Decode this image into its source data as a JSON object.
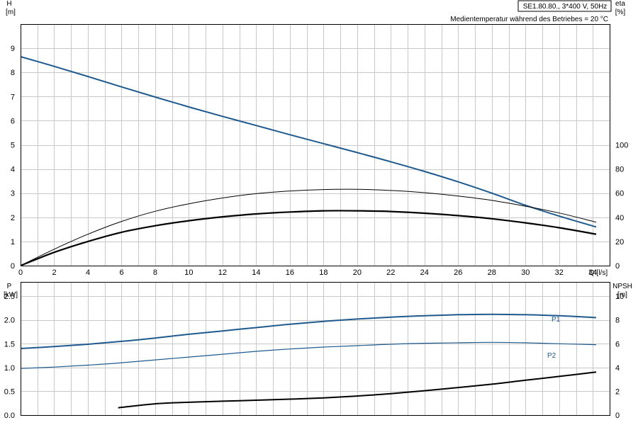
{
  "chart_data": [
    {
      "type": "line",
      "axis": {
        "xlabel": "Q [l/s]",
        "xlim": [
          0,
          35
        ],
        "xticks": [
          0,
          2,
          4,
          6,
          8,
          10,
          12,
          14,
          16,
          18,
          20,
          22,
          24,
          26,
          28,
          30,
          32,
          34
        ],
        "ylabel_line1": "H",
        "ylabel_line2": "[m]",
        "ylim": [
          0,
          10
        ],
        "yticks": [
          0,
          1,
          2,
          3,
          4,
          5,
          6,
          7,
          8,
          9
        ],
        "y2label_line1": "eta",
        "y2label_line2": "[%]",
        "y2lim": [
          0,
          200
        ],
        "y2ticks": [
          0,
          20,
          40,
          60,
          80,
          100
        ],
        "grid": true
      },
      "info": {
        "title": "SE1.80.80., 3*400 V, 50Hz",
        "note": "Medientemperatur während des Betriebes = 20 °C"
      },
      "series": [
        {
          "key": "head",
          "axis": "left",
          "color": "#1f5a8f",
          "width": 2,
          "x": [
            0,
            2,
            4,
            6,
            8,
            10,
            12,
            14,
            16,
            18,
            20,
            22,
            24,
            26,
            28,
            30,
            32,
            34.2
          ],
          "y": [
            8.65,
            8.25,
            7.83,
            7.4,
            6.98,
            6.57,
            6.18,
            5.8,
            5.42,
            5.05,
            4.68,
            4.3,
            3.9,
            3.47,
            3.0,
            2.5,
            2.05,
            1.6
          ]
        },
        {
          "key": "eta-thin",
          "axis": "left",
          "color": "#000000",
          "width": 1,
          "x": [
            0,
            2,
            4,
            6,
            8,
            10,
            12,
            14,
            16,
            18,
            20,
            22,
            24,
            26,
            28,
            30,
            32,
            34.2
          ],
          "y": [
            0,
            0.68,
            1.3,
            1.83,
            2.25,
            2.56,
            2.8,
            2.98,
            3.09,
            3.15,
            3.16,
            3.11,
            3.02,
            2.88,
            2.7,
            2.46,
            2.18,
            1.8
          ]
        },
        {
          "key": "eta-thick",
          "axis": "left",
          "color": "#000000",
          "width": 2.2,
          "x": [
            0,
            2,
            4,
            6,
            8,
            10,
            12,
            14,
            16,
            18,
            20,
            22,
            24,
            26,
            28,
            30,
            32,
            34.2
          ],
          "y": [
            0,
            0.55,
            1.0,
            1.38,
            1.65,
            1.86,
            2.02,
            2.14,
            2.22,
            2.27,
            2.27,
            2.24,
            2.17,
            2.07,
            1.94,
            1.77,
            1.57,
            1.3
          ]
        }
      ]
    },
    {
      "type": "line",
      "axis": {
        "xlim": [
          0,
          35
        ],
        "ylabel_line1": "P",
        "ylabel_line2": "[kW]",
        "ylim": [
          0,
          2.8
        ],
        "yticks": [
          0.0,
          0.5,
          1.0,
          1.5,
          2.0,
          2.5
        ],
        "ytick_labels": [
          "0.0",
          "0.5",
          "1.0",
          "1.5",
          "2.0",
          "2.5"
        ],
        "y2label_line1": "NPSH",
        "y2label_line2": "[m]",
        "y2lim": [
          0,
          11.2
        ],
        "y2ticks": [
          0,
          2,
          4,
          6,
          8,
          10
        ],
        "grid": true
      },
      "series": [
        {
          "key": "P1",
          "name": "P1",
          "axis": "left",
          "color": "#1f5a8f",
          "width": 2,
          "x": [
            0,
            2,
            4,
            6,
            8,
            10,
            12,
            14,
            16,
            18,
            20,
            22,
            24,
            26,
            28,
            30,
            32,
            34.2
          ],
          "y": [
            1.4,
            1.44,
            1.49,
            1.55,
            1.62,
            1.7,
            1.77,
            1.84,
            1.91,
            1.97,
            2.02,
            2.06,
            2.09,
            2.11,
            2.12,
            2.11,
            2.09,
            2.05
          ]
        },
        {
          "key": "P2",
          "name": "P2",
          "axis": "left",
          "color": "#1f5a8f",
          "width": 1.2,
          "x": [
            0,
            2,
            4,
            6,
            8,
            10,
            12,
            14,
            16,
            18,
            20,
            22,
            24,
            26,
            28,
            30,
            32,
            34.2
          ],
          "y": [
            0.98,
            1.01,
            1.05,
            1.1,
            1.16,
            1.22,
            1.28,
            1.34,
            1.39,
            1.43,
            1.46,
            1.49,
            1.51,
            1.52,
            1.53,
            1.52,
            1.5,
            1.48
          ]
        },
        {
          "key": "NPSH",
          "axis": "right",
          "color": "#000000",
          "width": 2,
          "x": [
            5.8,
            8,
            10,
            12,
            14,
            16,
            18,
            20,
            22,
            24,
            26,
            28,
            30,
            32,
            34.2
          ],
          "y": [
            0.62,
            0.95,
            1.08,
            1.17,
            1.25,
            1.34,
            1.45,
            1.6,
            1.8,
            2.05,
            2.32,
            2.6,
            2.93,
            3.25,
            3.62
          ]
        }
      ]
    }
  ]
}
